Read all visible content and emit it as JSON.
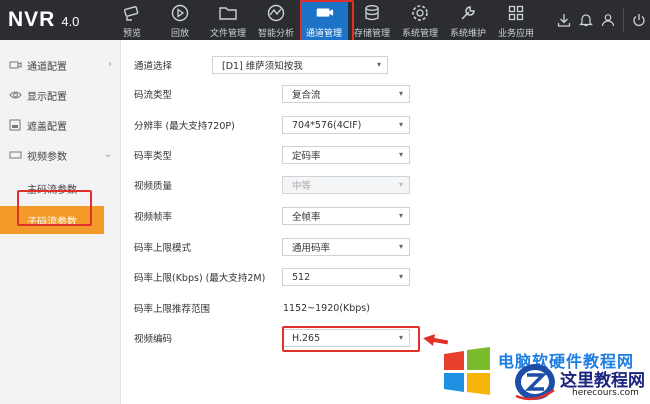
{
  "header": {
    "brand": "NVR",
    "version": "4.0",
    "nav": [
      {
        "label": "预览",
        "icon": "camera-icon"
      },
      {
        "label": "回放",
        "icon": "playback-icon"
      },
      {
        "label": "文件管理",
        "icon": "folder-icon"
      },
      {
        "label": "智能分析",
        "icon": "analytics-icon"
      },
      {
        "label": "通道管理",
        "icon": "channel-camera-icon"
      },
      {
        "label": "存储管理",
        "icon": "database-icon"
      },
      {
        "label": "系统管理",
        "icon": "gear-icon"
      },
      {
        "label": "系统维护",
        "icon": "wrench-icon"
      },
      {
        "label": "业务应用",
        "icon": "grid-icon"
      }
    ],
    "active_nav": "通道管理",
    "right_icons": [
      "download-icon",
      "bell-icon",
      "user-icon",
      "power-icon"
    ]
  },
  "sidebar": {
    "items": [
      {
        "label": "通道配置",
        "icon": "channel-config-icon",
        "expanded": false
      },
      {
        "label": "显示配置",
        "icon": "eye-icon",
        "expanded": false
      },
      {
        "label": "遮盖配置",
        "icon": "mask-icon",
        "expanded": false
      },
      {
        "label": "视频参数",
        "icon": "video-icon",
        "expanded": true
      }
    ],
    "sub_items": [
      {
        "label": "主码流参数",
        "active": false
      },
      {
        "label": "子码流参数",
        "active": true
      }
    ]
  },
  "form": {
    "channel": {
      "label": "通道选择",
      "value": "[D1] 维萨须知按我"
    },
    "fields": [
      {
        "label": "码流类型",
        "value": "复合流",
        "disabled": false
      },
      {
        "label": "分辨率 (最大支持720P)",
        "value": "704*576(4CIF)",
        "disabled": false
      },
      {
        "label": "码率类型",
        "value": "定码率",
        "disabled": false
      },
      {
        "label": "视频质量",
        "value": "中等",
        "disabled": true
      },
      {
        "label": "视频帧率",
        "value": "全帧率",
        "disabled": false
      },
      {
        "label": "码率上限模式",
        "value": "通用码率",
        "disabled": false
      },
      {
        "label": "码率上限(Kbps) (最大支持2M)",
        "value": "512",
        "disabled": false
      }
    ],
    "recommend": {
      "label": "码率上限推荐范围",
      "value": "1152~1920(Kbps)"
    },
    "codec": {
      "label": "视频编码",
      "value": "H.265"
    }
  },
  "watermark": {
    "line1": "电脑软硬件教程网",
    "line2": "这里教程网",
    "url": "herecours.com"
  },
  "colors": {
    "topbar": "#2b2d31",
    "active_nav": "#1d73c8",
    "active_sub": "#f39b2a",
    "highlight_border": "#e0302a"
  }
}
